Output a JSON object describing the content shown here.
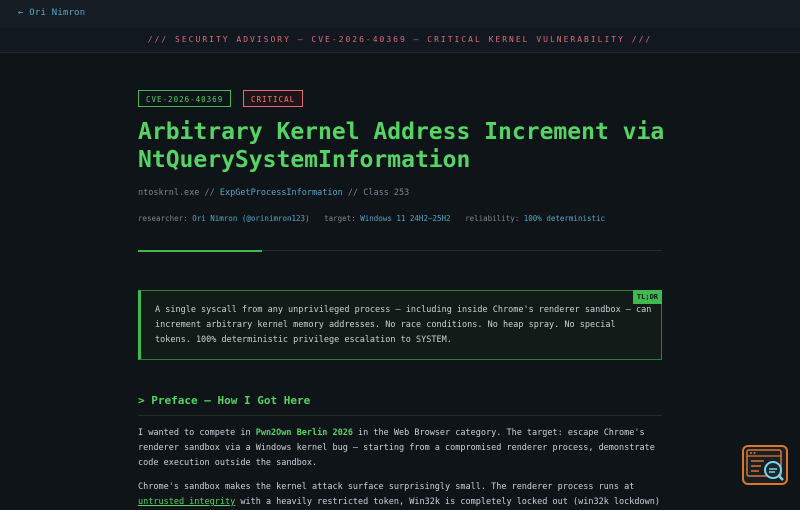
{
  "nav": {
    "back_label": "← Ori Nimron"
  },
  "advisory": {
    "text": "///   SECURITY ADVISORY — CVE-2026-40369 — CRITICAL KERNEL VULNERABILITY   ///"
  },
  "badges": {
    "cve": "CVE-2026-40369",
    "severity": "CRITICAL"
  },
  "title": "Arbitrary Kernel Address Increment via NtQuerySystemInformation",
  "meta": {
    "binary": "ntoskrnl.exe",
    "sep": " // ",
    "function": "ExpGetProcessInformation",
    "class": "Class 253",
    "researcher_label": "researcher:",
    "researcher": "Ori Nimron (@orinimron123)",
    "target_label": "target:",
    "target": "Windows 11 24H2–25H2",
    "reliability_label": "reliability:",
    "reliability": "100% deterministic"
  },
  "tldr": {
    "tag": "TL;DR",
    "text": "A single syscall from any unprivileged process — including inside Chrome's renderer sandbox — can increment arbitrary kernel memory addresses. No race conditions. No heap spray. No special tokens. 100% deterministic privilege escalation to SYSTEM."
  },
  "section": {
    "heading": "> Preface — How I Got Here"
  },
  "paragraph1": {
    "pre": "I wanted to compete in ",
    "highlight": "Pwn2Own Berlin 2026",
    "post": " in the Web Browser category. The target: escape Chrome's renderer sandbox via a Windows kernel bug — starting from a compromised renderer process, demonstrate code execution outside the sandbox."
  },
  "paragraph2": {
    "pre": "Chrome's sandbox makes the kernel attack surface surprisingly small. The renderer process runs at ",
    "highlight": "untrusted integrity",
    "post": " with a heavily restricted token, Win32k is completely locked out (win32k lockdown)"
  },
  "fab": {
    "icon": "terminal-search-icon"
  },
  "colors": {
    "accent": "#3fb950",
    "critical": "#e06c75",
    "link": "#58a6c8",
    "background": "#0f1419"
  }
}
